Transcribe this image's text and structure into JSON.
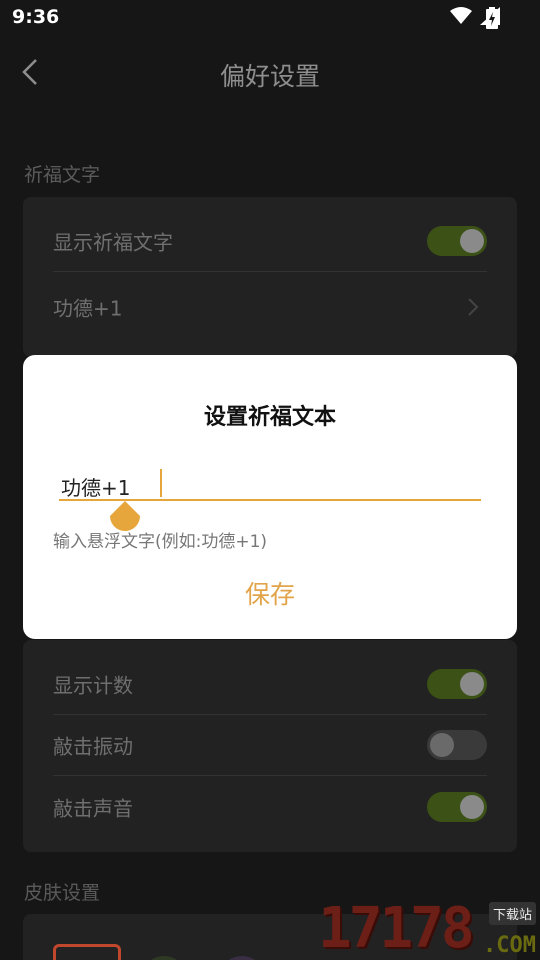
{
  "status_bar": {
    "time": "9:36"
  },
  "header": {
    "title": "偏好设置"
  },
  "sections": {
    "blessing": {
      "title": "祈福文字",
      "rows": [
        {
          "label": "显示祈福文字",
          "toggle": "on"
        },
        {
          "label": "功德+1"
        }
      ]
    },
    "counter": {
      "rows": [
        {
          "label": "显示计数",
          "toggle": "on"
        },
        {
          "label": "敲击振动",
          "toggle": "off"
        },
        {
          "label": "敲击声音",
          "toggle": "on"
        }
      ]
    },
    "skin": {
      "title": "皮肤设置"
    }
  },
  "dialog": {
    "title": "设置祈福文本",
    "input_value": "功德+1",
    "hint": "输入悬浮文字(例如:功德+1)",
    "save_label": "保存"
  },
  "watermark": {
    "number": "17178",
    "tag": "下载站",
    "domain": ".COM"
  },
  "colors": {
    "accent": "#e6a63c",
    "toggle_on": "#3b5116",
    "toggle_off": "#3a3a3a",
    "card": "#222222",
    "background": "#161616"
  }
}
